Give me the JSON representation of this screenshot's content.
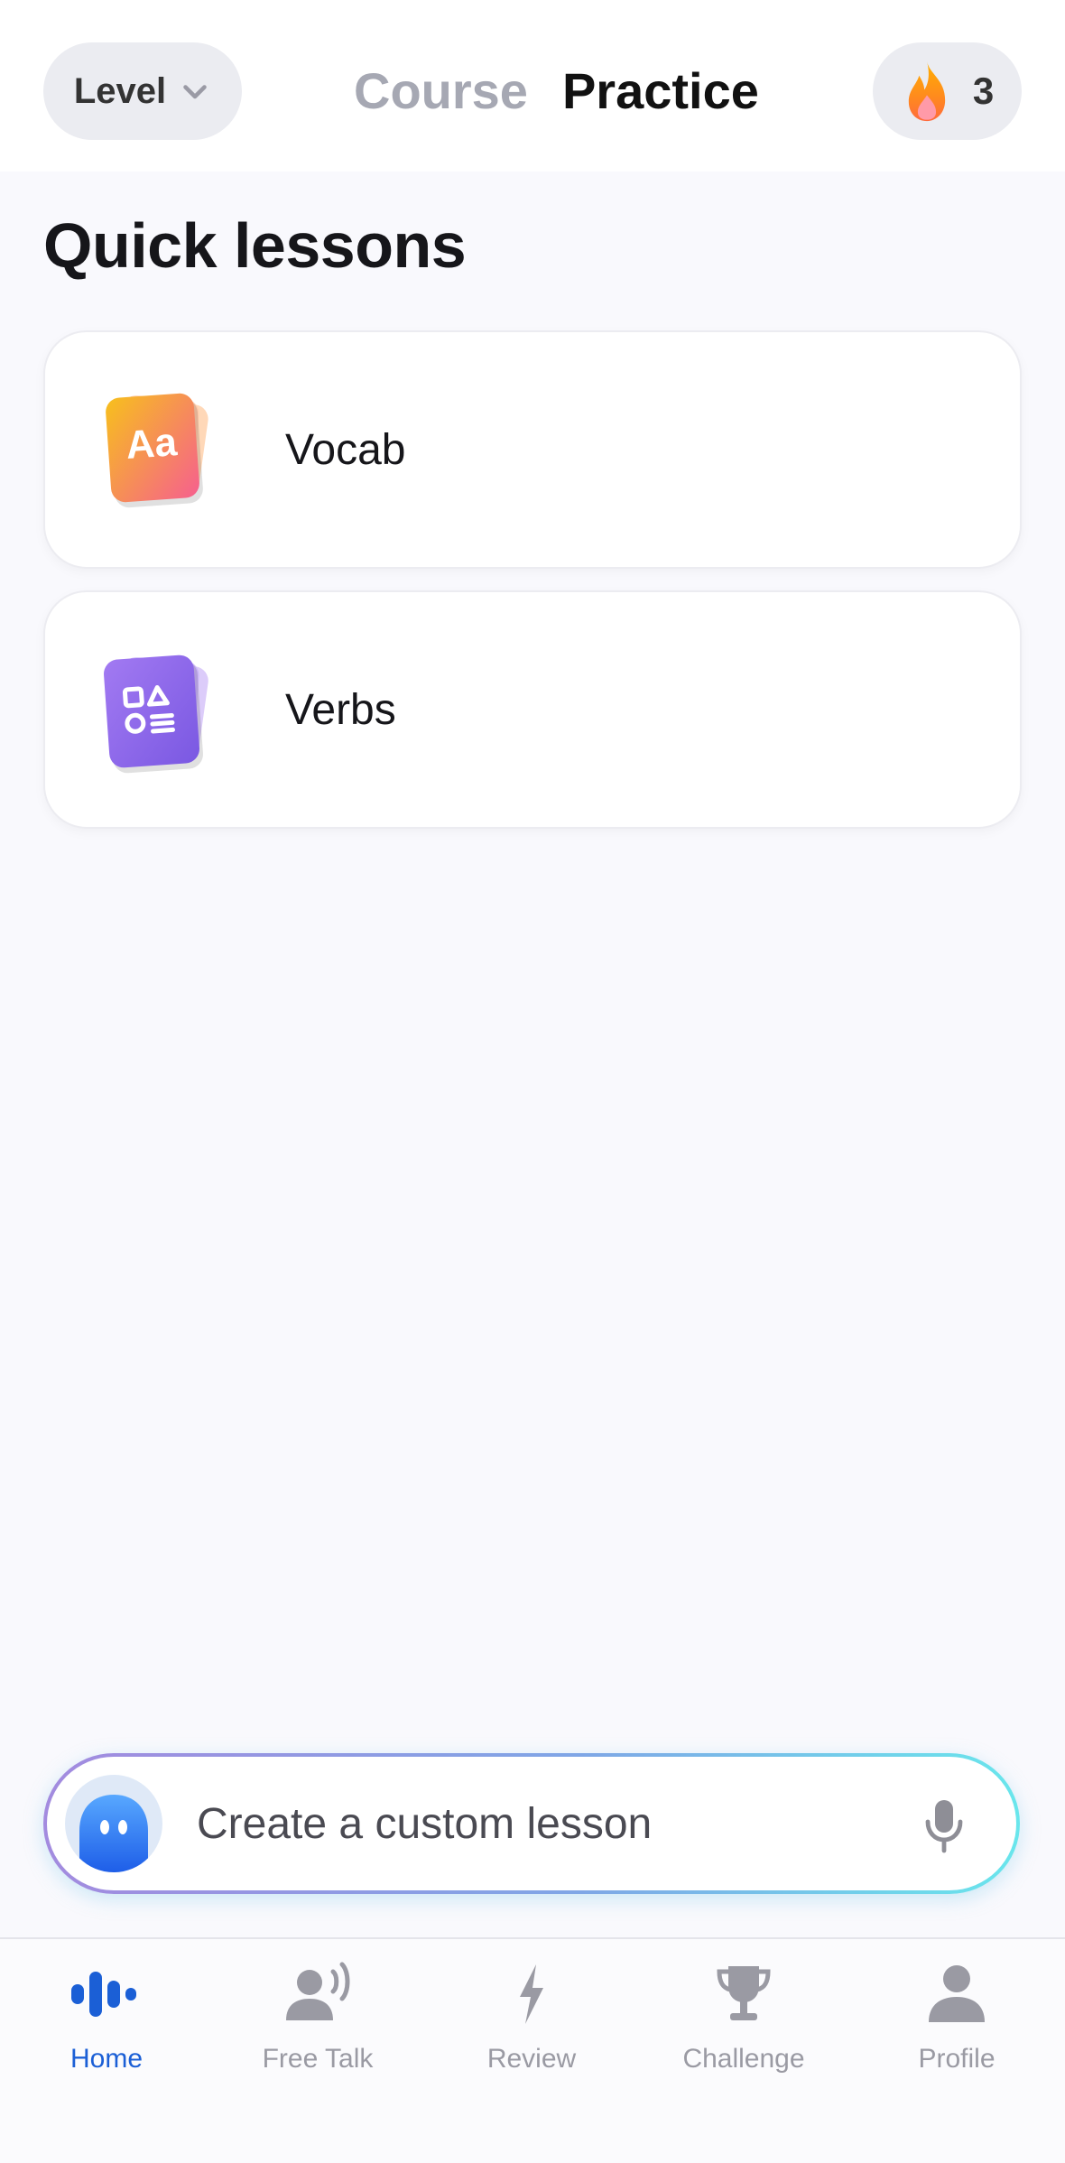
{
  "header": {
    "level_label": "Level",
    "tabs": [
      {
        "label": "Course",
        "active": false
      },
      {
        "label": "Practice",
        "active": true
      }
    ],
    "streak_count": "3",
    "streak_icon": "flame-icon"
  },
  "quick_lessons": {
    "title": "Quick lessons",
    "items": [
      {
        "label": "Vocab",
        "icon": "vocab-cards-icon",
        "icon_text": "Aa"
      },
      {
        "label": "Verbs",
        "icon": "verbs-shapes-icon"
      }
    ]
  },
  "custom_lesson": {
    "placeholder": "Create a custom lesson",
    "avatar_icon": "ai-bot-avatar-icon",
    "mic_icon": "microphone-icon"
  },
  "bottom_nav": {
    "items": [
      {
        "label": "Home",
        "icon": "sound-wave-icon",
        "active": true
      },
      {
        "label": "Free Talk",
        "icon": "person-speaking-icon",
        "active": false
      },
      {
        "label": "Review",
        "icon": "lightning-icon",
        "active": false
      },
      {
        "label": "Challenge",
        "icon": "trophy-icon",
        "active": false
      },
      {
        "label": "Profile",
        "icon": "person-icon",
        "active": false
      }
    ]
  },
  "colors": {
    "accent": "#1b5fd6",
    "inactive_tab": "#a6a8b3",
    "nav_inactive": "#9a9aa3",
    "vocab_gradient": [
      "#f6b81c",
      "#f6608c"
    ],
    "verbs_gradient": [
      "#9c6cf0",
      "#7b5ce6"
    ]
  }
}
